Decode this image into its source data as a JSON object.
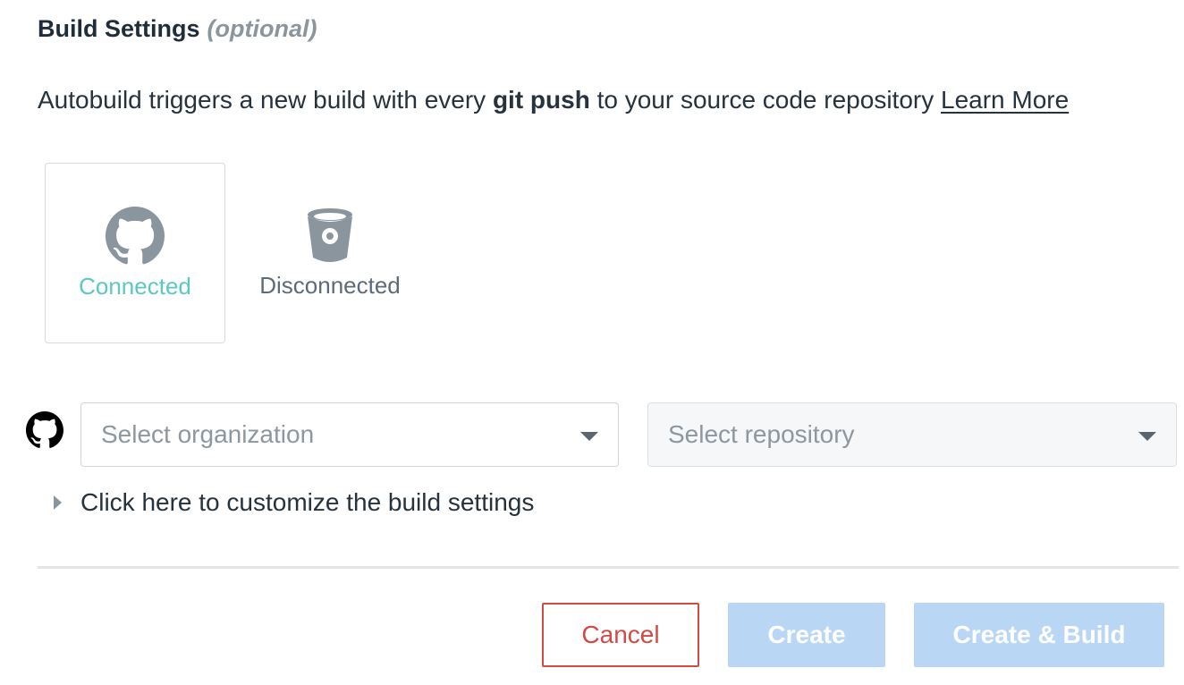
{
  "section": {
    "title": "Build Settings",
    "optional": "(optional)"
  },
  "description": {
    "prefix": "Autobuild triggers a new build with every ",
    "bold": "git push",
    "suffix": " to your source code repository ",
    "link": "Learn More"
  },
  "providers": [
    {
      "name": "github",
      "icon": "github-icon",
      "status": "Connected",
      "color": "#5cc7c4"
    },
    {
      "name": "bitbucket",
      "icon": "bitbucket-icon",
      "status": "Disconnected",
      "color": "#5d6b78"
    }
  ],
  "selects": {
    "organization": {
      "placeholder": "Select organization"
    },
    "repository": {
      "placeholder": "Select repository"
    }
  },
  "customize": {
    "label": "Click here to customize the build settings"
  },
  "buttons": {
    "cancel": "Cancel",
    "create": "Create",
    "create_build": "Create & Build"
  },
  "colors": {
    "accent_connected": "#5cc7c4",
    "cancel": "#d24a43",
    "primary_disabled": "#b9d7f5"
  }
}
